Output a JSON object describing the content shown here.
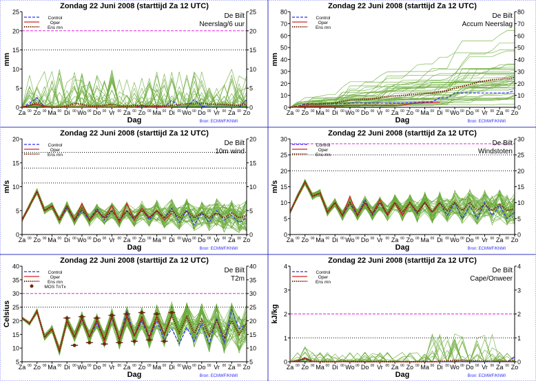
{
  "header": {
    "title": "Zondag    22 Juni      2008  (starttijd  Za 12 UTC)"
  },
  "common": {
    "location": "De Bilt",
    "xlabel": "Dag",
    "source": "Bron:  ECMWF/KNMI",
    "day_labels": [
      "Za",
      "Zo",
      "Ma",
      "Di",
      "Wo",
      "Do",
      "Vr",
      "Za",
      "Zo",
      "Ma",
      "Di",
      "Wo",
      "Do",
      "Vr",
      "Za",
      "Zo"
    ],
    "midnight_label": "00",
    "colors": {
      "control": "#2b2bff",
      "oper": "#d42020",
      "ensmean": "#7a2a10",
      "members": "#6aaa3a",
      "threshold_high": "#e020e0",
      "threshold": "#000000",
      "mos": "#6b2c10",
      "source": "#2b2bff"
    }
  },
  "chart_data": [
    {
      "type": "line",
      "variable": "Neerslag/6 uur",
      "ylabel": "mm",
      "ylim": [
        0,
        25
      ],
      "yticks": [
        0,
        5,
        10,
        15,
        20,
        25
      ],
      "legend": [
        "Control",
        "Oper",
        "Ens mn"
      ],
      "hlines": [
        {
          "value": 20,
          "color": "#e020e0"
        },
        {
          "value": 15,
          "color": "#000000"
        }
      ],
      "series": [
        {
          "name": "Control",
          "values": [
            0,
            1,
            2.5,
            0,
            0,
            0,
            0,
            0,
            0,
            0,
            0,
            0,
            0,
            0,
            0,
            0,
            0,
            0,
            0,
            0,
            1.8,
            0,
            0,
            2,
            0.3,
            0,
            0,
            0,
            0,
            0,
            2
          ]
        },
        {
          "name": "Oper",
          "values": [
            0,
            0.5,
            0.8,
            0.1,
            0,
            0,
            0,
            0,
            0,
            0,
            0,
            0,
            0,
            0,
            0,
            0,
            0.6,
            0,
            0.2,
            0,
            0
          ]
        },
        {
          "name": "Ens mn",
          "values": [
            0,
            0.5,
            1.2,
            0.3,
            0,
            0,
            0.3,
            1,
            0.8,
            0.3,
            0.3,
            0.5,
            0.8,
            0.3,
            0.3,
            0.5,
            0.4,
            0.3,
            0.4,
            0.3,
            0.5,
            0.7,
            0.9,
            0.9,
            1.1,
            0.8,
            0.8,
            0.7,
            0.6,
            0.5,
            0.8
          ]
        }
      ]
    },
    {
      "type": "line",
      "variable": "Accum Neerslag",
      "ylabel": "mm",
      "ylim": [
        0,
        80
      ],
      "yticks": [
        0,
        10,
        20,
        30,
        40,
        50,
        60,
        70,
        80
      ],
      "legend": [
        "Control",
        "Oper",
        "Ens mn"
      ],
      "hlines": [],
      "series": [
        {
          "name": "Control",
          "values": [
            0,
            1,
            2.8,
            3,
            3,
            3,
            3,
            3,
            3.5,
            3.5,
            3.5,
            3.5,
            3.5,
            3.5,
            3.5,
            3.5,
            4,
            4,
            4.5,
            4.5,
            8,
            8,
            12,
            12,
            12,
            12,
            12,
            12,
            12,
            12,
            14
          ]
        },
        {
          "name": "Oper",
          "values": [
            0,
            0.3,
            1,
            1,
            1,
            1,
            1.2,
            1.4,
            1.6,
            1.6,
            1.6,
            1.6,
            1.6,
            1.6,
            1.6,
            1.8,
            3,
            3.5,
            3.7,
            3.8,
            4
          ]
        },
        {
          "name": "Ens mn",
          "values": [
            0,
            0.5,
            2,
            2.5,
            2.7,
            3,
            3.5,
            5,
            6,
            6.5,
            6.8,
            7,
            8,
            9,
            9.5,
            10,
            10.5,
            11,
            11.5,
            12,
            13,
            14,
            16,
            17.5,
            19,
            21,
            22,
            23,
            23.5,
            24,
            25
          ]
        }
      ]
    },
    {
      "type": "line",
      "variable": "10m wind",
      "ylabel": "m/s",
      "ylim": [
        0,
        20
      ],
      "yticks": [
        0,
        5,
        10,
        15,
        20
      ],
      "legend": [
        "Control",
        "Oper",
        "Ens mn"
      ],
      "hlines": [
        {
          "value": 17.2,
          "color": "#000000"
        },
        {
          "value": 13.9,
          "color": "#000000"
        },
        {
          "value": 10.8,
          "color": "#000000"
        }
      ],
      "series": [
        {
          "name": "Control",
          "values": [
            3,
            6,
            9,
            5,
            6,
            3,
            5.5,
            3,
            5,
            3,
            5.5,
            3,
            5,
            3,
            5,
            3,
            5.5,
            3,
            5,
            3.5,
            5.5,
            2.5,
            5,
            2,
            4.5,
            2.5,
            5,
            3,
            4,
            2.5,
            3.5
          ]
        },
        {
          "name": "Oper",
          "values": [
            3,
            6,
            9,
            5,
            6,
            3,
            6,
            3,
            6.5,
            3,
            5,
            3.5,
            6,
            2.5,
            6.5,
            3,
            5.5,
            3.5,
            5,
            3,
            4.5
          ]
        },
        {
          "name": "Ens mn",
          "values": [
            3,
            6,
            9,
            5,
            6,
            3,
            6,
            3,
            5.5,
            3,
            5,
            3.5,
            5,
            3,
            5,
            3.5,
            5,
            3.5,
            5,
            3.5,
            5,
            3.5,
            5,
            3.5,
            4.5,
            3.5,
            4.5,
            3.5,
            4.5,
            3.5,
            4
          ]
        }
      ]
    },
    {
      "type": "line",
      "variable": "Windstoten",
      "ylabel": "m/s",
      "ylim": [
        0,
        30
      ],
      "yticks": [
        0,
        5,
        10,
        15,
        20,
        25,
        30
      ],
      "legend": [
        "Control",
        "Oper",
        "Ens mn"
      ],
      "hlines": [
        {
          "value": 28.5,
          "color": "#e020e0"
        },
        {
          "value": 25,
          "color": "#000000"
        },
        {
          "value": 20,
          "color": "#000000"
        }
      ],
      "series": [
        {
          "name": "Control",
          "values": [
            7,
            12,
            16.5,
            12,
            13,
            7,
            10,
            6,
            10,
            6,
            11,
            6,
            10,
            6,
            10,
            6,
            10,
            6.5,
            10,
            7,
            10,
            6,
            10,
            5,
            9,
            5,
            10,
            6,
            9,
            5,
            7
          ]
        },
        {
          "name": "Oper",
          "values": [
            7,
            12,
            16.5,
            12,
            13,
            7,
            10,
            6,
            12,
            6,
            10,
            6.5,
            11,
            6,
            10,
            6,
            10,
            7,
            10,
            7,
            10
          ]
        },
        {
          "name": "Ens mn",
          "values": [
            7,
            12,
            16.5,
            12,
            13,
            7,
            10,
            6,
            10,
            6,
            10,
            6.5,
            10,
            6.5,
            10,
            7,
            10,
            7,
            10,
            7,
            10,
            7.5,
            10,
            7.5,
            10,
            7.5,
            9.5,
            7.5,
            9.5,
            7.5,
            8
          ]
        }
      ]
    },
    {
      "type": "line",
      "variable": "T2m",
      "ylabel": "Celsius",
      "ylim": [
        5,
        40
      ],
      "yticks": [
        5,
        10,
        15,
        20,
        25,
        30,
        35,
        40
      ],
      "legend": [
        "Control",
        "Oper",
        "Ens mn",
        "MOS TnTx"
      ],
      "hlines": [
        {
          "value": 30,
          "color": "#e020e0"
        },
        {
          "value": 25,
          "color": "#000000"
        }
      ],
      "series": [
        {
          "name": "Control",
          "values": [
            21,
            19,
            23.5,
            14,
            17,
            9,
            20,
            14,
            20.5,
            14,
            19,
            13,
            21,
            13,
            23.5,
            14.5,
            20,
            13.5,
            20,
            13,
            17,
            11.5,
            17.5,
            12.5,
            19,
            11.5,
            21,
            12,
            24,
            17,
            19
          ]
        },
        {
          "name": "Oper",
          "values": [
            21,
            19,
            23.5,
            14,
            17,
            9,
            20,
            14,
            21,
            14,
            20.5,
            12.5,
            22,
            13,
            22,
            14.5,
            21.5,
            14,
            21.5,
            15,
            22
          ]
        },
        {
          "name": "Ens mn",
          "values": [
            21,
            19,
            23.5,
            14,
            17,
            9,
            20,
            14,
            21,
            14,
            20,
            13,
            21.5,
            13,
            21.5,
            14.5,
            21,
            14,
            21.5,
            15,
            22,
            15.5,
            21.5,
            15.5,
            20.5,
            14.5,
            20,
            14,
            20,
            15,
            19
          ]
        }
      ],
      "mos": {
        "name": "MOS TnTx",
        "points": [
          [
            6,
            21
          ],
          [
            7,
            11
          ],
          [
            8,
            21.5
          ],
          [
            9,
            12
          ],
          [
            10,
            21
          ],
          [
            11,
            11.5
          ],
          [
            12,
            22
          ],
          [
            13,
            12
          ],
          [
            14,
            22.5
          ],
          [
            15,
            12.5
          ],
          [
            16,
            23
          ],
          [
            17,
            13
          ],
          [
            18,
            22.5
          ],
          [
            19,
            12.5
          ],
          [
            20,
            23
          ]
        ]
      }
    },
    {
      "type": "line",
      "variable": "Cape/Onweer",
      "ylabel": "kJ/kg",
      "ylim": [
        0,
        4
      ],
      "yticks": [
        0,
        1,
        2,
        3,
        4
      ],
      "legend": [
        "Control",
        "Oper",
        "Ens mn"
      ],
      "hlines": [
        {
          "value": 2,
          "color": "#e020e0"
        },
        {
          "value": 1,
          "color": "#000000"
        }
      ],
      "series": [
        {
          "name": "Control",
          "values": [
            0,
            0.03,
            0.12,
            0,
            0,
            0,
            0,
            0,
            0,
            0,
            0,
            0,
            0,
            0,
            0,
            0,
            0,
            0,
            0.03,
            0,
            0,
            0,
            0.02,
            0,
            0,
            0,
            0,
            0,
            0,
            0,
            0.2
          ]
        },
        {
          "name": "Oper",
          "values": [
            0,
            0.04,
            0.15,
            0.01,
            0,
            0,
            0,
            0,
            0,
            0,
            0,
            0,
            0,
            0,
            0,
            0,
            0,
            0,
            0,
            0,
            0
          ]
        },
        {
          "name": "Ens mn",
          "values": [
            0,
            0.04,
            0.15,
            0.02,
            0,
            0,
            0,
            0.02,
            0.01,
            0,
            0,
            0,
            0.01,
            0,
            0,
            0,
            0,
            0,
            0.01,
            0,
            0.02,
            0.03,
            0.06,
            0.05,
            0.05,
            0.03,
            0.03,
            0.02,
            0.02,
            0.02,
            0.03
          ]
        }
      ]
    }
  ]
}
